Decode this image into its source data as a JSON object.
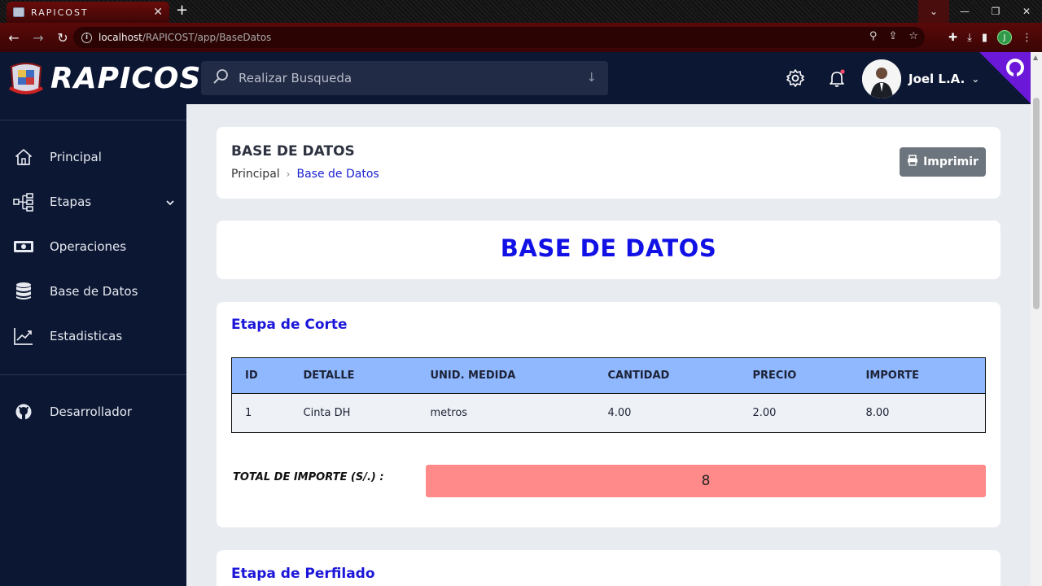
{
  "browser": {
    "tab_title": "RAPICOST",
    "url_host": "localhost",
    "url_path": "/RAPICOST/app/BaseDatos",
    "profile_initial": "J"
  },
  "app": {
    "brand": "RAPICOST",
    "search_placeholder": "Realizar Busqueda",
    "user_name": "Joel L.A."
  },
  "sidebar": {
    "items": [
      {
        "label": "Principal",
        "icon": "home-icon"
      },
      {
        "label": "Etapas",
        "icon": "sitemap-icon"
      },
      {
        "label": "Operaciones",
        "icon": "money-bill-icon"
      },
      {
        "label": "Base de Datos",
        "icon": "database-icon"
      },
      {
        "label": "Estadisticas",
        "icon": "chart-line-icon"
      }
    ],
    "developer": {
      "label": "Desarrollador",
      "icon": "github-icon"
    }
  },
  "page": {
    "title": "BASE DE DATOS",
    "breadcrumb": [
      "Principal",
      "Base de Datos"
    ],
    "print_label": "Imprimir",
    "banner_title": "BASE DE DATOS"
  },
  "sections": [
    {
      "title": "Etapa de Corte",
      "columns": [
        "ID",
        "DETALLE",
        "UNID. MEDIDA",
        "CANTIDAD",
        "PRECIO",
        "IMPORTE"
      ],
      "rows": [
        [
          "1",
          "Cinta DH",
          "metros",
          "4.00",
          "2.00",
          "8.00"
        ]
      ],
      "total_label": "TOTAL DE IMPORTE (S/.) :",
      "total_value": "8"
    },
    {
      "title": "Etapa de Perfilado"
    }
  ],
  "colors": {
    "sidebar_bg": "#0c1733",
    "accent_blue": "#1111e6",
    "table_header": "#8fb8ff",
    "total_bg": "#ff8a89",
    "print_button": "#6c757d"
  }
}
